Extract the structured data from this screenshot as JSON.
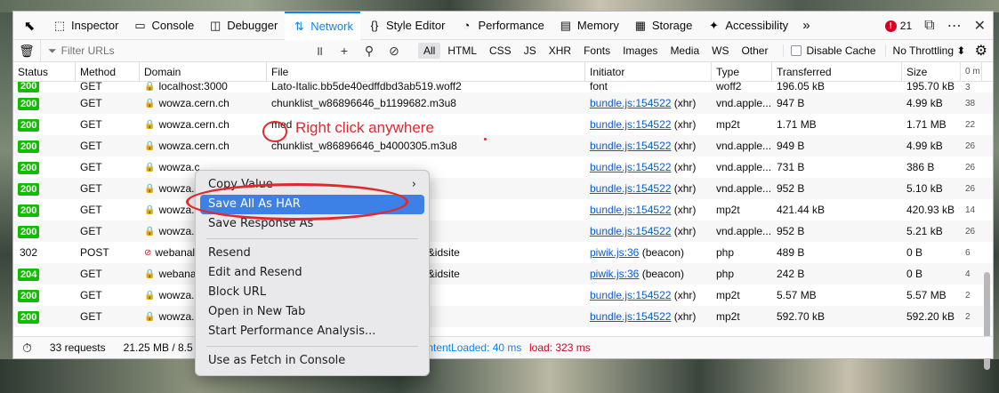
{
  "tabs": [
    {
      "icon": "inspector-icon",
      "label": "Inspector",
      "glyph": "⬚"
    },
    {
      "icon": "console-icon",
      "label": "Console",
      "glyph": "▭"
    },
    {
      "icon": "debugger-icon",
      "label": "Debugger",
      "glyph": "◫"
    },
    {
      "icon": "network-icon",
      "label": "Network",
      "glyph": "⇅"
    },
    {
      "icon": "style-editor-icon",
      "label": "Style Editor",
      "glyph": "{}"
    },
    {
      "icon": "performance-icon",
      "label": "Performance",
      "glyph": "◔"
    },
    {
      "icon": "memory-icon",
      "label": "Memory",
      "glyph": "▤"
    },
    {
      "icon": "storage-icon",
      "label": "Storage",
      "glyph": "▦"
    },
    {
      "icon": "accessibility-icon",
      "label": "Accessibility",
      "glyph": "✦"
    }
  ],
  "error_count": "21",
  "toolbar": {
    "filter_placeholder": "Filter URLs",
    "types": [
      "All",
      "HTML",
      "CSS",
      "JS",
      "XHR",
      "Fonts",
      "Images",
      "Media",
      "WS",
      "Other"
    ],
    "disable_cache": "Disable Cache",
    "throttling": "No Throttling ⬍"
  },
  "columns": [
    "Status",
    "Method",
    "Domain",
    "File",
    "Initiator",
    "Type",
    "Transferred",
    "Size",
    "0 m"
  ],
  "rows": [
    {
      "status": "200",
      "method": "GET",
      "domain": "localhost:3000",
      "secure": true,
      "file": "Lato-Italic.bb5de40edffdbd3ab519.woff2",
      "init_link": "",
      "init_rest": "font",
      "type": "woff2",
      "transferred": "196.05 kB",
      "size": "195.70 kB",
      "wf": "3"
    },
    {
      "status": "200",
      "method": "GET",
      "domain": "wowza.cern.ch",
      "secure": true,
      "file": "chunklist_w86896646_b1199682.m3u8",
      "init_link": "bundle.js:154522",
      "init_rest": " (xhr)",
      "type": "vnd.apple...",
      "transferred": "947 B",
      "size": "4.99 kB",
      "wf": "38"
    },
    {
      "status": "200",
      "method": "GET",
      "domain": "wowza.cern.ch",
      "secure": true,
      "file": "med",
      "init_link": "bundle.js:154522",
      "init_rest": " (xhr)",
      "type": "mp2t",
      "transferred": "1.71 MB",
      "size": "1.71 MB",
      "wf": "22"
    },
    {
      "status": "200",
      "method": "GET",
      "domain": "wowza.cern.ch",
      "secure": true,
      "file": "chunklist_w86896646_b4000305.m3u8",
      "init_link": "bundle.js:154522",
      "init_rest": " (xhr)",
      "type": "vnd.apple...",
      "transferred": "949 B",
      "size": "4.99 kB",
      "wf": "26"
    },
    {
      "status": "200",
      "method": "GET",
      "domain": "wowza.c",
      "secure": true,
      "file": "",
      "init_link": "bundle.js:154522",
      "init_rest": " (xhr)",
      "type": "vnd.apple...",
      "transferred": "731 B",
      "size": "386 B",
      "wf": "26"
    },
    {
      "status": "200",
      "method": "GET",
      "domain": "wowza.c",
      "secure": true,
      "file": "5565.m3u8",
      "init_link": "bundle.js:154522",
      "init_rest": " (xhr)",
      "type": "vnd.apple...",
      "transferred": "952 B",
      "size": "5.10 kB",
      "wf": "26"
    },
    {
      "status": "200",
      "method": "GET",
      "domain": "wowza.c",
      "secure": true,
      "file": "65_0.ts",
      "init_link": "bundle.js:154522",
      "init_rest": " (xhr)",
      "type": "mp2t",
      "transferred": "421.44 kB",
      "size": "420.93 kB",
      "wf": "14"
    },
    {
      "status": "200",
      "method": "GET",
      "domain": "wowza.c",
      "secure": true,
      "file": "52831.m3u8",
      "init_link": "bundle.js:154522",
      "init_rest": " (xhr)",
      "type": "vnd.apple...",
      "transferred": "952 B",
      "size": "5.21 kB",
      "wf": "26"
    },
    {
      "status": "302",
      "method": "POST",
      "domain": "webanal",
      "secure": false,
      "file": "er&e_a=paella:play&e_n=/&ca=1&idsite",
      "init_link": "piwik.js:36",
      "init_rest": " (beacon)",
      "type": "php",
      "transferred": "489 B",
      "size": "0 B",
      "wf": "6"
    },
    {
      "status": "204",
      "method": "GET",
      "domain": "webanal",
      "secure": true,
      "file": "er&e_a=paella:play&e_n=/&ca=1&idsite",
      "init_link": "piwik.js:36",
      "init_rest": " (beacon)",
      "type": "php",
      "transferred": "242 B",
      "size": "0 B",
      "wf": "4"
    },
    {
      "status": "200",
      "method": "GET",
      "domain": "wowza.c",
      "secure": true,
      "file": "05_1.ts",
      "init_link": "bundle.js:154522",
      "init_rest": " (xhr)",
      "type": "mp2t",
      "transferred": "5.57 MB",
      "size": "5.57 MB",
      "wf": "2"
    },
    {
      "status": "200",
      "method": "GET",
      "domain": "wowza.c",
      "secure": true,
      "file": "831_1.ts",
      "init_link": "bundle.js:154522",
      "init_rest": " (xhr)",
      "type": "mp2t",
      "transferred": "592.70 kB",
      "size": "592.20 kB",
      "wf": "2"
    }
  ],
  "statusbar": {
    "requests": "33 requests",
    "transferred": "21.25 MB / 8.5",
    "dcl": "ContentLoaded: 40 ms",
    "load": "load: 323 ms"
  },
  "context_menu": {
    "copy_value": "Copy Value",
    "save_all_har": "Save All As HAR",
    "save_response": "Save Response As",
    "resend": "Resend",
    "edit_resend": "Edit and Resend",
    "block_url": "Block URL",
    "open_new_tab": "Open in New Tab",
    "perf_analysis": "Start Performance Analysis...",
    "fetch_console": "Use as Fetch in Console"
  },
  "annotation": {
    "text": "Right click anywhere",
    "color": "#e3272b"
  }
}
